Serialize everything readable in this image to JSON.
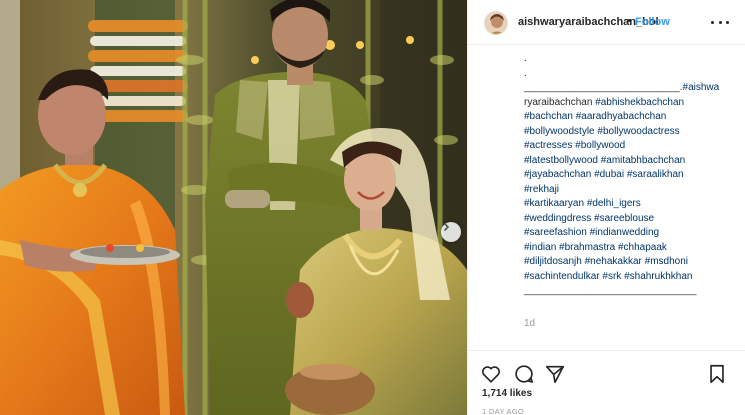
{
  "post": {
    "username": "aishwaryaraibachchan_bol",
    "separator": "•",
    "follow_label": "Follow",
    "caption_dots": [
      ".",
      "."
    ],
    "caption_lines": [
      "____________________________.#aishwa",
      "ryaraibachchan #abhishekbachchan",
      "#bachchan #aaradhyabachchan",
      "#bollywoodstyle #bollywoodactress",
      "#actresses #bollywood",
      "#latestbollywood #amitabhbachchan",
      "#jayabachchan #dubai #saraalikhan",
      "#rekhaji",
      "#kartikaaryan #delhi_igers",
      "#weddingdress #sareeblouse",
      "#sareefashion #indianwedding",
      "#indian #brahmastra #chhapaak",
      "#diljitdosanjh #nehakakkar #msdhoni",
      "#sachintendulkar #srk #shahrukhkhan",
      "_______________________________"
    ],
    "caption_time": "1d",
    "likes": "1,714 likes",
    "posted_ago": "1 DAY AGO"
  },
  "icons": {
    "more": "more-options-icon",
    "like": "heart-icon",
    "comment": "comment-icon",
    "share": "paper-plane-icon",
    "save": "bookmark-icon",
    "next": "chevron-right-icon"
  },
  "colors": {
    "follow": "#3897f0",
    "hashtag": "#003569",
    "muted": "#999999",
    "saree_orange": "#e8891c",
    "kurta_green": "#7a7f2a",
    "gold": "#c9b25a"
  }
}
